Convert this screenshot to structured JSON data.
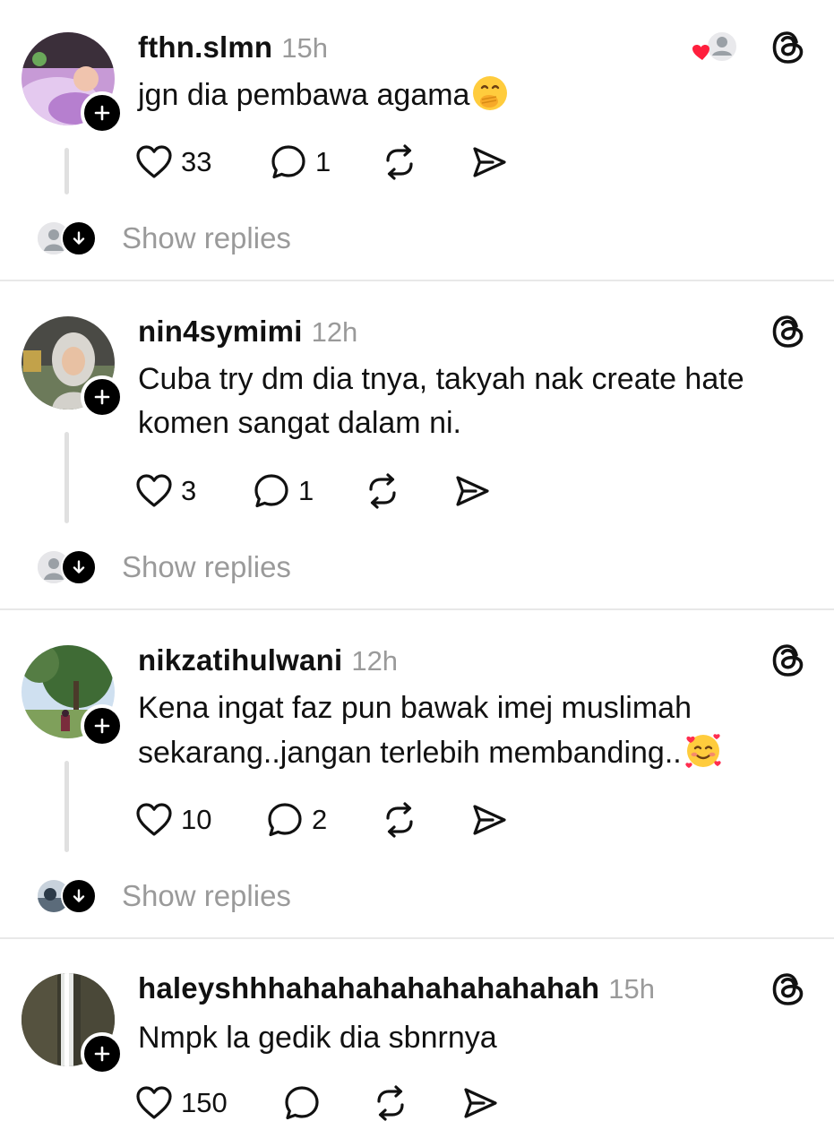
{
  "posts": [
    {
      "username": "fthn.slmn",
      "time": "15h",
      "text": "jgn dia pembawa agama",
      "emoji": "hand-over-mouth-emoji",
      "likes": "33",
      "replies": "1",
      "show_replies": "Show replies",
      "liked_by_author": true
    },
    {
      "username": "nin4symimi",
      "time": "12h",
      "text": "Cuba try dm dia tnya, takyah nak create hate komen sangat dalam ni.",
      "likes": "3",
      "replies": "1",
      "show_replies": "Show replies"
    },
    {
      "username": "nikzatihulwani",
      "time": "12h",
      "text": "Kena ingat faz pun bawak imej muslimah sekarang..jangan terlebih membanding..",
      "emoji": "smiling-face-with-hearts-emoji",
      "likes": "10",
      "replies": "2",
      "show_replies": "Show replies"
    },
    {
      "username": "haleyshhhahahahahahahahahah",
      "time": "15h",
      "text": "Nmpk la gedik dia sbnrnya",
      "likes": "150",
      "replies": ""
    }
  ],
  "icons": {
    "like": "heart-outline-icon",
    "reply": "speech-bubble-icon",
    "repost": "repost-icon",
    "share": "send-icon",
    "brand": "threads-icon",
    "follow": "plus-icon",
    "expand": "arrow-down-icon"
  },
  "colors": {
    "text": "#111111",
    "muted": "#9a9a9a",
    "divider": "#e8e8e8",
    "like_red": "#ff1f3d"
  }
}
